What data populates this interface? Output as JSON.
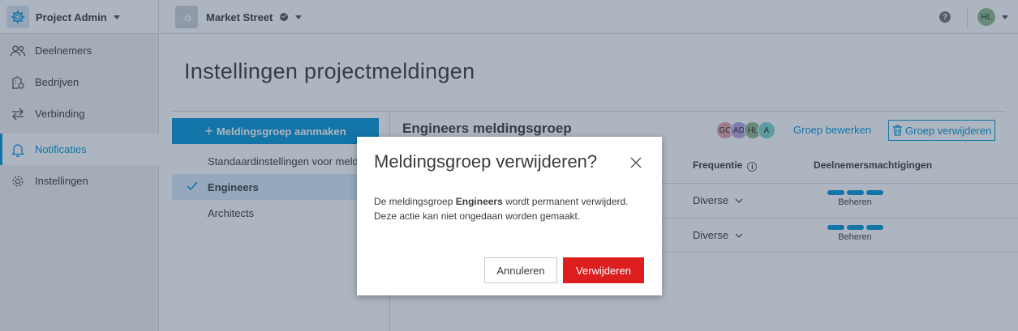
{
  "header": {
    "app_title": "Project Admin",
    "project_name": "Market Street",
    "help_label": "?",
    "user_initials": "HL"
  },
  "sidebar": {
    "items": [
      {
        "label": "Deelnemers",
        "icon": "people-icon"
      },
      {
        "label": "Bedrijven",
        "icon": "building-icon"
      },
      {
        "label": "Verbinding",
        "icon": "arrows-exchange-icon"
      },
      {
        "label": "Notificaties",
        "icon": "bell-icon",
        "active": true
      },
      {
        "label": "Instellingen",
        "icon": "gear-icon"
      }
    ]
  },
  "main": {
    "page_title": "Instellingen projectmeldingen",
    "create_button": "Meldingsgroep aanmaken",
    "groups": [
      {
        "label": "Standaardinstellingen voor meldingen"
      },
      {
        "label": "Engineers",
        "selected": true
      },
      {
        "label": "Architects"
      }
    ],
    "group_title": "Engineers meldingsgroep",
    "members": [
      {
        "initials": "GC",
        "color": "#e8a3a3"
      },
      {
        "initials": "AD",
        "color": "#b9a6e3"
      },
      {
        "initials": "HL",
        "color": "#8dbb8f"
      },
      {
        "initials": "A",
        "color": "#7fd3cf"
      }
    ],
    "edit_group": "Groep bewerken",
    "delete_group": "Groep verwijderen",
    "columns": {
      "frequency": "Frequentie",
      "permissions": "Deelnemersmachtigingen"
    },
    "rows": [
      {
        "frequency": "Diverse",
        "permission": "Beheren"
      },
      {
        "frequency": "Diverse",
        "permission": "Beheren"
      }
    ]
  },
  "modal": {
    "title": "Meldingsgroep verwijderen?",
    "body_prefix": "De meldingsgroep ",
    "body_group": "Engineers",
    "body_suffix": " wordt permanent verwijderd.",
    "body_line2": "Deze actie kan niet ongedaan worden gemaakt.",
    "cancel": "Annuleren",
    "confirm": "Verwijderen"
  },
  "colors": {
    "accent": "#0696d7",
    "danger": "#dc1e1e"
  }
}
